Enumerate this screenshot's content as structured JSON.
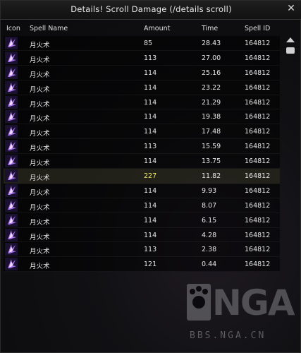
{
  "window": {
    "title": "Details! Scroll Damage (/details scroll)"
  },
  "columns": {
    "icon": "Icon",
    "spell_name": "Spell Name",
    "amount": "Amount",
    "time": "Time",
    "spell_id": "Spell ID"
  },
  "rows": [
    {
      "icon": "spell-icon",
      "name": "月火术",
      "amount": "85",
      "time": "28.43",
      "spell_id": "164812"
    },
    {
      "icon": "spell-icon",
      "name": "月火术",
      "amount": "113",
      "time": "27.00",
      "spell_id": "164812"
    },
    {
      "icon": "spell-icon",
      "name": "月火术",
      "amount": "114",
      "time": "25.16",
      "spell_id": "164812"
    },
    {
      "icon": "spell-icon",
      "name": "月火术",
      "amount": "114",
      "time": "23.22",
      "spell_id": "164812"
    },
    {
      "icon": "spell-icon",
      "name": "月火术",
      "amount": "114",
      "time": "21.29",
      "spell_id": "164812"
    },
    {
      "icon": "spell-icon",
      "name": "月火术",
      "amount": "114",
      "time": "19.38",
      "spell_id": "164812"
    },
    {
      "icon": "spell-icon",
      "name": "月火术",
      "amount": "114",
      "time": "17.48",
      "spell_id": "164812"
    },
    {
      "icon": "spell-icon",
      "name": "月火术",
      "amount": "113",
      "time": "15.59",
      "spell_id": "164812"
    },
    {
      "icon": "spell-icon",
      "name": "月火术",
      "amount": "114",
      "time": "13.75",
      "spell_id": "164812"
    },
    {
      "icon": "spell-icon",
      "name": "月火术",
      "amount": "227",
      "time": "11.82",
      "spell_id": "164812",
      "highlight": true
    },
    {
      "icon": "spell-icon",
      "name": "月火术",
      "amount": "114",
      "time": "9.93",
      "spell_id": "164812"
    },
    {
      "icon": "spell-icon",
      "name": "月火术",
      "amount": "114",
      "time": "8.07",
      "spell_id": "164812"
    },
    {
      "icon": "spell-icon",
      "name": "月火术",
      "amount": "114",
      "time": "6.15",
      "spell_id": "164812"
    },
    {
      "icon": "spell-icon",
      "name": "月火术",
      "amount": "114",
      "time": "4.28",
      "spell_id": "164812"
    },
    {
      "icon": "spell-icon",
      "name": "月火术",
      "amount": "113",
      "time": "2.38",
      "spell_id": "164812"
    },
    {
      "icon": "spell-icon",
      "name": "月火术",
      "amount": "121",
      "time": "0.44",
      "spell_id": "164812"
    }
  ],
  "colors": {
    "highlight_amount": "#f2e86a",
    "text": "#e6e6e6",
    "icon_glow": "#c58cff"
  },
  "watermark": {
    "brand": "NGA",
    "url": "BBS.NGA.CN"
  }
}
